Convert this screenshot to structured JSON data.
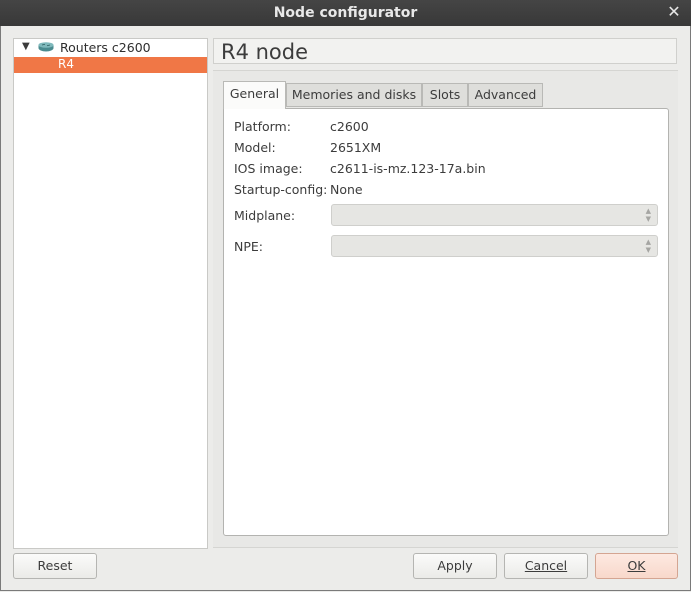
{
  "window": {
    "title": "Node configurator"
  },
  "tree": {
    "root_label": "Routers c2600",
    "child_label": "R4"
  },
  "node_title": "R4 node",
  "tabs": [
    "General",
    "Memories and disks",
    "Slots",
    "Advanced"
  ],
  "general": {
    "platform_label": "Platform:",
    "platform_value": "c2600",
    "model_label": "Model:",
    "model_value": "2651XM",
    "ios_label": "IOS image:",
    "ios_value": "c2611-is-mz.123-17a.bin",
    "startup_label": "Startup-config:",
    "startup_value": "None",
    "midplane_label": "Midplane:",
    "midplane_value": "",
    "npe_label": "NPE:",
    "npe_value": ""
  },
  "buttons": {
    "reset": "Reset",
    "apply": "Apply",
    "cancel": "Cancel",
    "ok": "OK"
  },
  "colors": {
    "selection": "#f07746",
    "titlebar": "#3c3c3c"
  },
  "icons": {
    "close": "close-icon",
    "router": "router-icon",
    "expand": "triangle-down-icon"
  }
}
